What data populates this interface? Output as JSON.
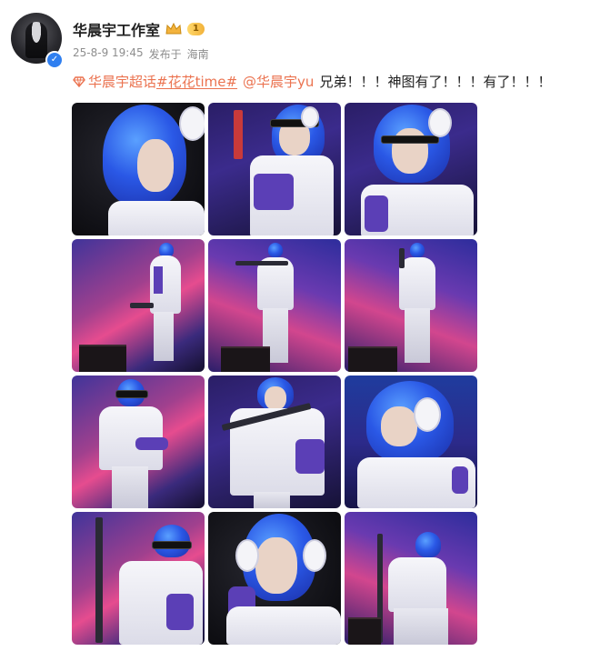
{
  "post": {
    "username": "华晨宇工作室",
    "level": "1",
    "timestamp": "25-8-9 19:45",
    "source_prefix": "发布于",
    "location": "海南",
    "content": {
      "topic_link": "华晨宇超话",
      "hashtag": "#花花time#",
      "mention": "@华晨宇yu",
      "text": "兄弟！！！神图有了！！！有了！！！"
    },
    "photos": [
      {
        "label": "photo-1"
      },
      {
        "label": "photo-2"
      },
      {
        "label": "photo-3"
      },
      {
        "label": "photo-4"
      },
      {
        "label": "photo-5"
      },
      {
        "label": "photo-6"
      },
      {
        "label": "photo-7"
      },
      {
        "label": "photo-8"
      },
      {
        "label": "photo-9"
      },
      {
        "label": "photo-10"
      },
      {
        "label": "photo-11"
      },
      {
        "label": "photo-12"
      }
    ]
  },
  "colors": {
    "link": "#eb7350",
    "meta_text": "#8e8e8e",
    "verify_badge": "#2f7ff0",
    "hair_blue": "#2a58e6"
  },
  "icons": {
    "verified": "verified-badge-icon",
    "crown": "crown-icon",
    "topic": "diamond-topic-icon"
  }
}
